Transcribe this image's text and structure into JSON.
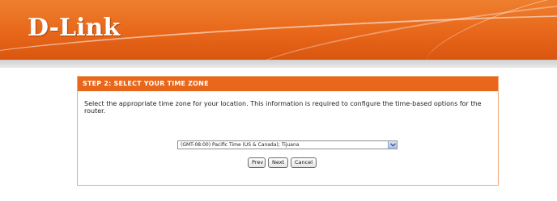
{
  "header": {
    "logo_text": "D-Link"
  },
  "wizard": {
    "title": "STEP 2: SELECT YOUR TIME ZONE",
    "description": "Select the appropriate time zone for your location. This information is required to configure the time-based options for the router.",
    "timezone_select": {
      "selected": "(GMT-08:00) Pacific Time (US & Canada); Tijuana"
    },
    "buttons": {
      "prev": "Prev",
      "next": "Next",
      "cancel": "Cancel"
    }
  },
  "colors": {
    "brand_orange": "#e8671a",
    "panel_border": "#f0a878"
  }
}
